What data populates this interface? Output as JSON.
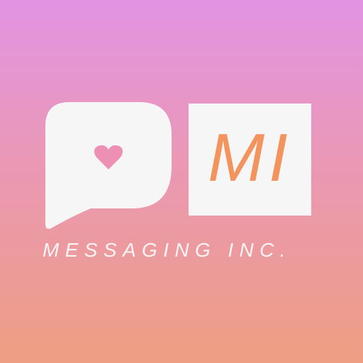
{
  "logo": {
    "monogram": "MI",
    "tagline": "MESSAGING INC.",
    "icons": {
      "bubble": "speech-bubble-icon",
      "heart": "heart-icon"
    },
    "colors": {
      "gradient_top": "#e294e3",
      "gradient_bottom": "#ee9e82",
      "accent": "#f3935e",
      "heart": "#ee8fb4",
      "white": "#f7f6f6"
    }
  }
}
